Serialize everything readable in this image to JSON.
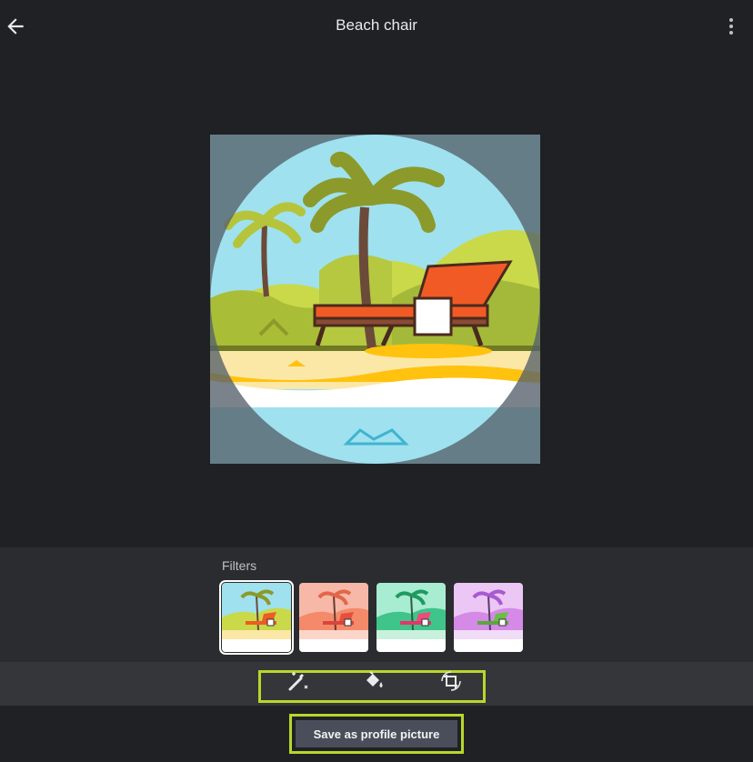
{
  "header": {
    "title": "Beach chair",
    "back_icon": "arrow-left-icon",
    "more_icon": "more-vert-icon"
  },
  "image": {
    "subject": "beach chair under palm trees"
  },
  "filters": {
    "label": "Filters",
    "options": [
      {
        "palette": "original",
        "selected": true
      },
      {
        "palette": "coral",
        "selected": false
      },
      {
        "palette": "mint",
        "selected": false
      },
      {
        "palette": "violet",
        "selected": false
      }
    ]
  },
  "tools": [
    {
      "icon": "magic-wand-icon"
    },
    {
      "icon": "paint-bucket-icon"
    },
    {
      "icon": "crop-rotate-icon"
    }
  ],
  "actions": {
    "save_label": "Save as profile picture"
  },
  "colors": {
    "background": "#202124",
    "highlight": "#b6d82b",
    "button": "#4a4e5a"
  }
}
